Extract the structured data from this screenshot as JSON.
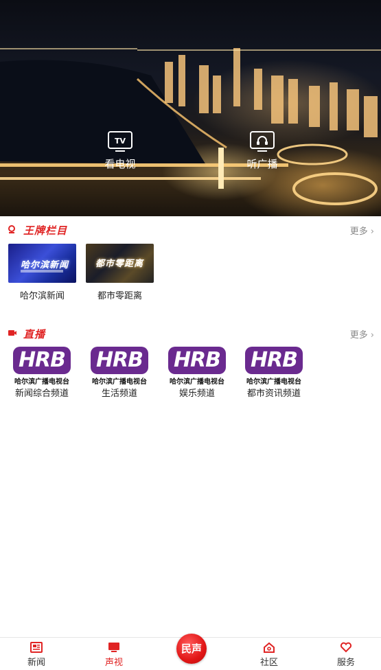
{
  "hero": {
    "tv_label": "看电视",
    "tv_icon_text": "TV",
    "radio_label": "听广播"
  },
  "featured": {
    "title": "王牌栏目",
    "more": "更多",
    "items": [
      {
        "label": "哈尔滨新闻",
        "art": "哈尔滨新闻"
      },
      {
        "label": "都市零距离",
        "art": "都市零距离"
      }
    ]
  },
  "live": {
    "title": "直播",
    "more": "更多",
    "logo_text": "HRB",
    "station_text": "哈尔滨广播电视台",
    "items": [
      {
        "label": "新闻综合频道"
      },
      {
        "label": "生活频道"
      },
      {
        "label": "娱乐频道"
      },
      {
        "label": "都市资讯频道"
      }
    ]
  },
  "nav": {
    "items": [
      {
        "label": "新闻",
        "icon": "news-icon"
      },
      {
        "label": "声视",
        "icon": "tv-icon",
        "active": true
      },
      {
        "label": "民声",
        "icon": "center-button"
      },
      {
        "label": "社区",
        "icon": "home-icon"
      },
      {
        "label": "服务",
        "icon": "heart-icon"
      }
    ]
  },
  "colors": {
    "accent": "#e02424",
    "hrb_purple": "#6a2a8f"
  }
}
